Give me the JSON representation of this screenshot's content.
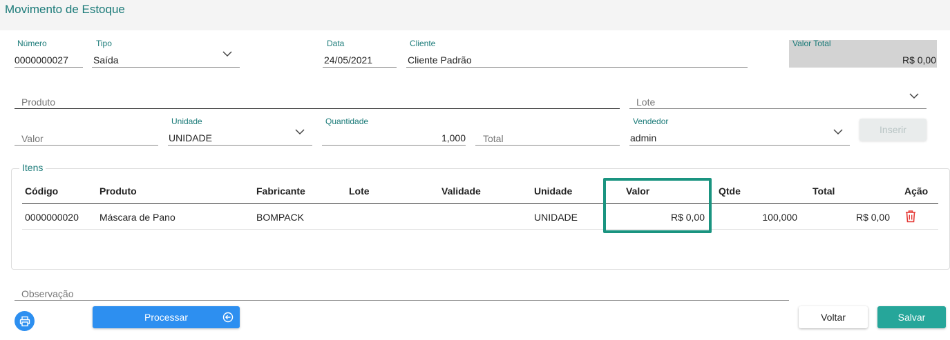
{
  "header": {
    "title": "Movimento de Estoque"
  },
  "form": {
    "numero": {
      "label": "Número",
      "value": "0000000027"
    },
    "tipo": {
      "label": "Tipo",
      "value": "Saída"
    },
    "data": {
      "label": "Data",
      "value": "24/05/2021"
    },
    "cliente": {
      "label": "Cliente",
      "value": "Cliente Padrão"
    },
    "valor_total": {
      "label": "Valor Total",
      "value": "R$ 0,00"
    },
    "produto": {
      "placeholder": "Produto"
    },
    "lote": {
      "placeholder": "Lote"
    },
    "valor": {
      "placeholder": "Valor"
    },
    "unidade": {
      "label": "Unidade",
      "value": "UNIDADE"
    },
    "quantidade": {
      "label": "Quantidade",
      "value": "1,000"
    },
    "total": {
      "placeholder": "Total"
    },
    "vendedor": {
      "label": "Vendedor",
      "value": "admin"
    },
    "inserir_label": "Inserir"
  },
  "itens": {
    "legend": "Itens",
    "columns": [
      "Código",
      "Produto",
      "Fabricante",
      "Lote",
      "Validade",
      "Unidade",
      "Valor",
      "Qtde",
      "Total",
      "Ação"
    ],
    "rows": [
      {
        "codigo": "0000000020",
        "produto": "Máscara de Pano",
        "fabricante": "BOMPACK",
        "lote": "",
        "validade": "",
        "unidade": "UNIDADE",
        "valor": "R$ 0,00",
        "qtde": "100,000",
        "total": "R$ 0,00"
      }
    ]
  },
  "observacao": {
    "placeholder": "Observação"
  },
  "buttons": {
    "processar": "Processar",
    "voltar": "Voltar",
    "salvar": "Salvar"
  },
  "icons": {
    "print": "printer-icon",
    "processar": "circle-arrow-left-icon",
    "delete": "trash-icon",
    "dropdown": "chevron-down-icon"
  },
  "colors": {
    "accent": "#1a7a78",
    "primary_blue": "#2d8ff0",
    "save_green": "#26a69a",
    "highlight": "#1a9480",
    "delete_red": "#e53935"
  }
}
